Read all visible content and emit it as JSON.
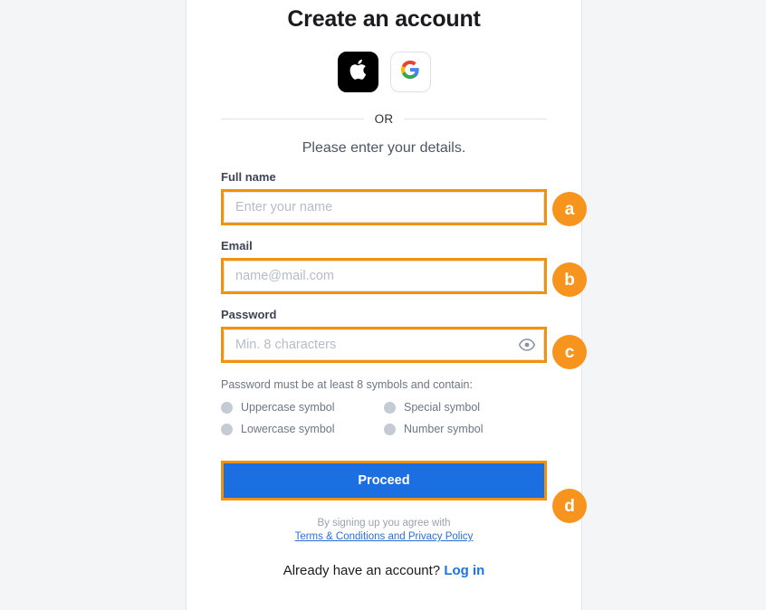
{
  "page": {
    "title": "Create an account",
    "subtitle": "Please enter your details.",
    "divider_label": "OR"
  },
  "social": {
    "buttons": [
      {
        "name": "apple-signin-button",
        "icon": "apple-icon",
        "label": "Apple"
      },
      {
        "name": "google-signin-button",
        "icon": "google-icon",
        "label": "Google"
      }
    ]
  },
  "form": {
    "fields": [
      {
        "label": "Full name",
        "placeholder": "Enter your name",
        "value": "",
        "highlighted": true
      },
      {
        "label": "Email",
        "placeholder": "name@mail.com",
        "value": "",
        "highlighted": true
      },
      {
        "label": "Password",
        "placeholder": "Min. 8 characters",
        "value": "",
        "highlighted": true,
        "toggle_icon": "eye-icon"
      }
    ]
  },
  "password_rules": {
    "hint": "Password must be at least 8 symbols and contain:",
    "items": [
      {
        "label": "Uppercase symbol",
        "met": false
      },
      {
        "label": "Special symbol",
        "met": false
      },
      {
        "label": "Lowercase symbol",
        "met": false
      },
      {
        "label": "Number symbol",
        "met": false
      }
    ]
  },
  "actions": {
    "proceed_label": "Proceed"
  },
  "footer": {
    "terms_prefix": "By signing up you agree with",
    "terms_link": "Terms & Conditions and Privacy Policy",
    "login_prompt": "Already have an account?",
    "login_link": "Log in"
  },
  "annotations": [
    {
      "id": "a",
      "label": "a",
      "target": "full-name-input"
    },
    {
      "id": "b",
      "label": "b",
      "target": "email-input"
    },
    {
      "id": "c",
      "label": "c",
      "target": "password-input"
    },
    {
      "id": "d",
      "label": "d",
      "target": "proceed-button"
    }
  ],
  "colors": {
    "background": "#f4f5f7",
    "card": "#ffffff",
    "accent_blue": "#1b6fe0",
    "annotation_orange": "#f7941d",
    "highlight_orange": "#f2920b",
    "muted_text": "#6c7685"
  }
}
